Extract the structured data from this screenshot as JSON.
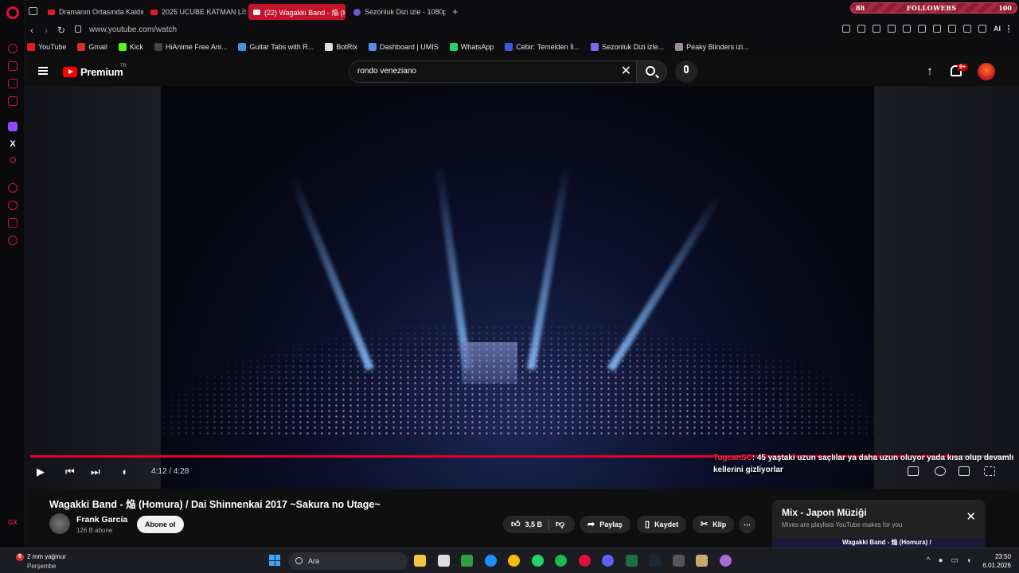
{
  "browser": {
    "tabs": [
      {
        "title": "Dramanın Ortasında Kaldım",
        "active": false
      },
      {
        "title": "2025 UCUBE KATMAN LİS",
        "active": false
      },
      {
        "title": "(22) Wagakki Band - 焔 (H",
        "active": true
      },
      {
        "title": "Sezonluk Dizi izle - 1080p",
        "active": false
      }
    ],
    "new_tab_icon": "+",
    "followers": {
      "left_count": "88",
      "label": "FOLLOWERS",
      "right_count": "100",
      "progress": 0.88
    },
    "url": "www.youtube.com/watch",
    "ai_label": "AI",
    "bookmarks": [
      {
        "label": "YouTube",
        "color": "#e31b23"
      },
      {
        "label": "Gmail",
        "color": "#d93025"
      },
      {
        "label": "Kick",
        "color": "#53fc18"
      },
      {
        "label": "HiAnime Free Ani...",
        "color": "#444444"
      },
      {
        "label": "Guitar Tabs with R...",
        "color": "#4a90e2"
      },
      {
        "label": "BotRix",
        "color": "#dddddd"
      },
      {
        "label": "Dashboard | UMIS",
        "color": "#5b8def"
      },
      {
        "label": "WhatsApp",
        "color": "#25d366"
      },
      {
        "label": "Cebir: Temelden İl...",
        "color": "#3a5bd9"
      },
      {
        "label": "Sezonluk Dizi izle...",
        "color": "#7b68ee"
      },
      {
        "label": "Peaky Blinders izi...",
        "color": "#9a8c98"
      }
    ],
    "gx_label": "GX"
  },
  "youtube": {
    "logo_word": "Premium",
    "region": "TR",
    "search_value": "rondo veneziano",
    "clear_icon": "✕",
    "notifications_badge": "9+",
    "player": {
      "current_time": "4:12",
      "duration": "4:28",
      "progress": 0.94,
      "chat_user": "TugcanSC",
      "chat_message": ": 45 yaştaki uzun saçlılar ya daha uzun oluyor yada kısa olup devamlı kellerini gizliyorlar"
    },
    "video": {
      "title": "Wagakki Band - 焔 (Homura) / Dai Shinnenkai 2017 ~Sakura no Utage~",
      "channel": "Frank García",
      "subscribers": "126 B abone",
      "subscribe_label": "Abone ol",
      "likes": "3,5 B",
      "share_label": "Paylaş",
      "save_label": "Kaydet",
      "clip_label": "Klip",
      "more_label": "⋯"
    },
    "mix": {
      "title": "Mix - Japon Müziği",
      "subtitle": "Mixes are playlists YouTube makes for you",
      "close_icon": "✕",
      "first_item": "Wagakki Band - 焔 (Homura) /"
    }
  },
  "taskbar": {
    "weather_badge": "6",
    "weather_temp": "2 mm yağmur",
    "weather_day": "Perşembe",
    "search_placeholder": "Ara",
    "time": "23:50",
    "date": "6.01.2026",
    "apps": [
      {
        "name": "file-explorer",
        "color": "#f5c542"
      },
      {
        "name": "store",
        "color": "#dddddd"
      },
      {
        "name": "xbox",
        "color": "#2ea043"
      },
      {
        "name": "edge",
        "color": "#1e90ff"
      },
      {
        "name": "chrome",
        "color": "#fbbc05"
      },
      {
        "name": "whatsapp",
        "color": "#25d366"
      },
      {
        "name": "spotify",
        "color": "#1db954"
      },
      {
        "name": "opera-gx",
        "color": "#e0103a"
      },
      {
        "name": "discord",
        "color": "#5865f2"
      },
      {
        "name": "excel",
        "color": "#1d7044"
      },
      {
        "name": "steam",
        "color": "#1b2838"
      },
      {
        "name": "obs",
        "color": "#555555"
      },
      {
        "name": "league",
        "color": "#c8aa6e"
      },
      {
        "name": "media-player",
        "color": "#a86bd9"
      }
    ]
  }
}
